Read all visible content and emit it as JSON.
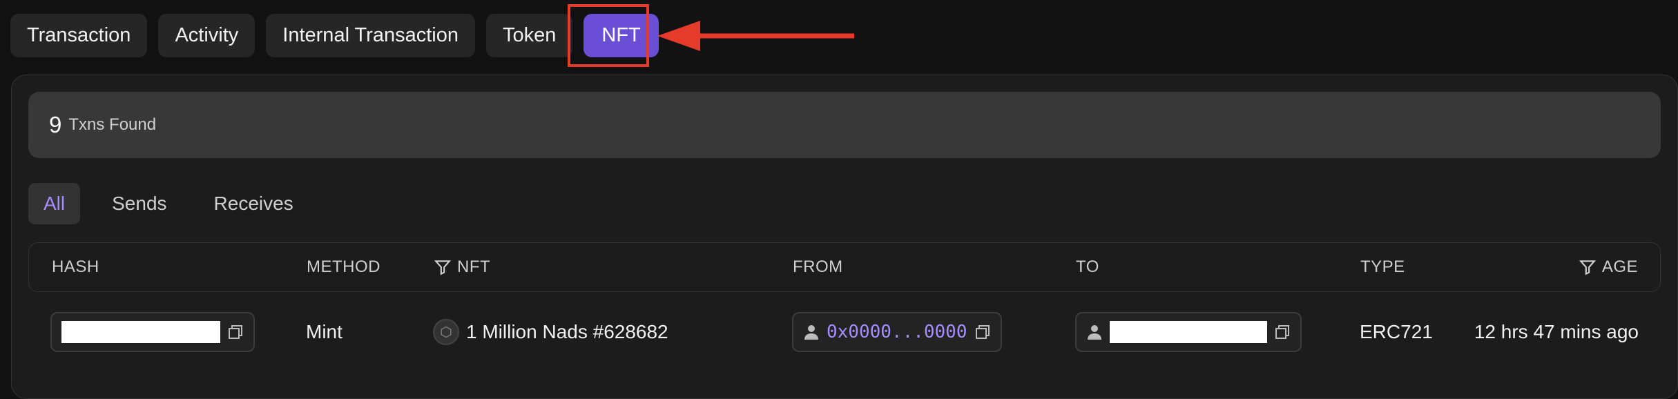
{
  "tabs": [
    {
      "label": "Transaction"
    },
    {
      "label": "Activity"
    },
    {
      "label": "Internal Transaction"
    },
    {
      "label": "Token"
    },
    {
      "label": "NFT"
    }
  ],
  "summary": {
    "count": "9",
    "label": "Txns Found"
  },
  "filters": [
    {
      "label": "All"
    },
    {
      "label": "Sends"
    },
    {
      "label": "Receives"
    }
  ],
  "table": {
    "columns": {
      "hash": "HASH",
      "method": "METHOD",
      "nft": "NFT",
      "from": "FROM",
      "to": "TO",
      "type": "TYPE",
      "age": "AGE"
    },
    "rows": [
      {
        "method": "Mint",
        "nft": "1 Million Nads #628682",
        "from": "0x0000...0000",
        "type": "ERC721",
        "age": "12 hrs 47 mins ago"
      }
    ]
  },
  "colors": {
    "accent": "#6a4fd6",
    "highlight": "#e63a2a",
    "link": "#a58cff"
  }
}
